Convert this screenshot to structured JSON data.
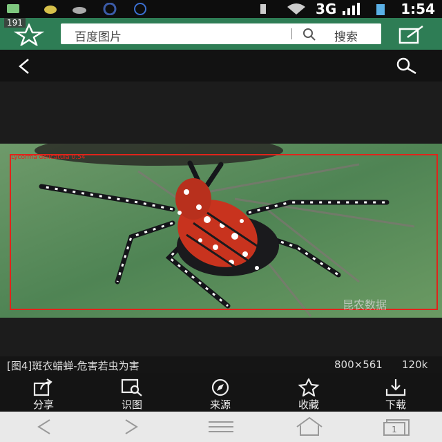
{
  "status_bar": {
    "network": "3G",
    "time": "1:54"
  },
  "header": {
    "badge": "191",
    "search_placeholder": "百度图片",
    "search_button": "搜索"
  },
  "image": {
    "detection_label": "Lycorma delicatula 0.54",
    "watermark": "昆农数据"
  },
  "caption": {
    "title": "[图4]斑衣蜡蝉-危害若虫为害",
    "dimensions": "800×561",
    "size": "120k"
  },
  "toolbar": [
    {
      "label": "分享",
      "icon": "share-icon"
    },
    {
      "label": "识图",
      "icon": "image-search-icon"
    },
    {
      "label": "来源",
      "icon": "compass-icon"
    },
    {
      "label": "收藏",
      "icon": "star-icon"
    },
    {
      "label": "下载",
      "icon": "download-icon"
    }
  ],
  "colors": {
    "header_green": "#2e7d55",
    "box_red": "#e0241b"
  }
}
